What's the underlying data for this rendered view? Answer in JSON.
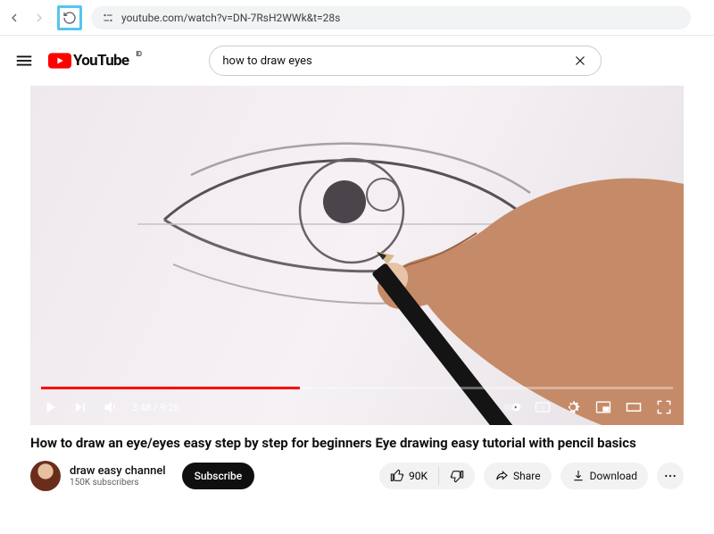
{
  "browser": {
    "url": "youtube.com/watch?v=DN-7RsH2WWk&t=28s"
  },
  "header": {
    "logo_text": "YouTube",
    "country_code": "ID",
    "search_value": "how to draw eyes"
  },
  "player": {
    "current_time": "3:48",
    "duration": "9:26",
    "progress_pct": 41
  },
  "video": {
    "title": "How to draw an eye/eyes easy step by step for beginners Eye drawing easy tutorial with pencil basics"
  },
  "channel": {
    "name": "draw easy channel",
    "subscribers": "150K subscribers"
  },
  "actions": {
    "subscribe": "Subscribe",
    "likes": "90K",
    "share": "Share",
    "download": "Download"
  }
}
